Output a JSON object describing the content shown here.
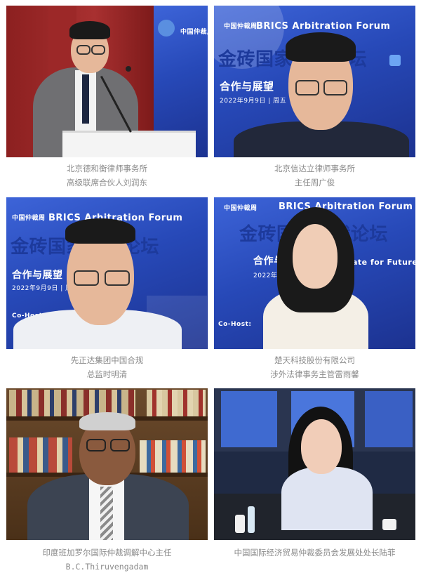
{
  "panels": [
    {
      "caption": [
        "北京德和衡律师事务所",
        "高级联席合伙人刘润东"
      ]
    },
    {
      "caption": [
        "北京信达立律师事务所",
        "主任周广俊"
      ]
    },
    {
      "caption": [
        "先正达集团中国合规",
        "总监时明清"
      ]
    },
    {
      "caption": [
        "楚天科技股份有限公司",
        "涉外法律事务主管雷雨馨"
      ]
    },
    {
      "caption": [
        "印度班加罗尔国际仲裁调解中心主任",
        "B.C.Thiruvengadam"
      ]
    },
    {
      "caption": [
        "中国国际经济贸易仲裁委员会发展处处长陆菲"
      ]
    }
  ],
  "banner": {
    "forum_en": "BRICS Arbitration Forum",
    "forum_cn": "金砖国家仲裁论坛",
    "theme_cn": "合作与展望",
    "theme_en": "Cooperate for Future",
    "date": "2022年9月9日 | 周五",
    "logo": "中国仲裁周",
    "cohost": "Co-Host:"
  }
}
